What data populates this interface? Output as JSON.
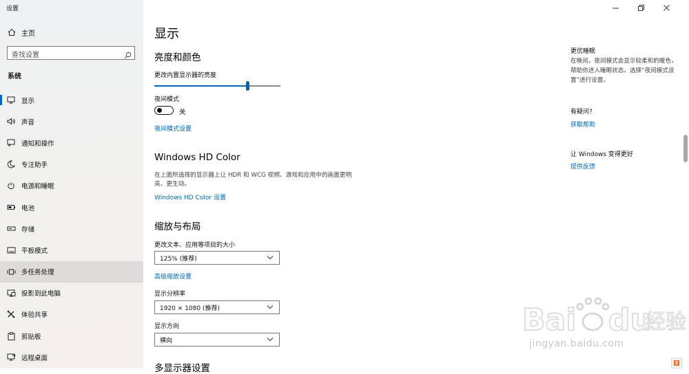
{
  "app": {
    "title": "设置"
  },
  "sidebar": {
    "home_label": "主页",
    "search_placeholder": "查找设置",
    "section_label": "系统",
    "items": [
      {
        "label": "显示",
        "icon": "monitor-icon"
      },
      {
        "label": "声音",
        "icon": "speaker-icon"
      },
      {
        "label": "通知和操作",
        "icon": "notification-icon"
      },
      {
        "label": "专注助手",
        "icon": "moon-icon"
      },
      {
        "label": "电源和睡眠",
        "icon": "power-icon"
      },
      {
        "label": "电池",
        "icon": "battery-icon"
      },
      {
        "label": "存储",
        "icon": "storage-icon"
      },
      {
        "label": "平板模式",
        "icon": "tablet-icon"
      },
      {
        "label": "多任务处理",
        "icon": "multitask-icon"
      },
      {
        "label": "投影到此电脑",
        "icon": "project-icon"
      },
      {
        "label": "体验共享",
        "icon": "share-icon"
      },
      {
        "label": "剪贴板",
        "icon": "clipboard-icon"
      },
      {
        "label": "远程桌面",
        "icon": "remote-icon"
      }
    ],
    "selected_index": 0,
    "hovered_index": 8
  },
  "main": {
    "page_title": "显示",
    "brightness": {
      "heading": "亮度和颜色",
      "slider_label": "更改内置显示器的亮度",
      "slider_value": 0.74,
      "night_label": "夜间模式",
      "night_state": "关",
      "night_link": "夜间模式设置"
    },
    "hdr": {
      "heading": "Windows HD Color",
      "desc": "在上面所选择的显示器上让 HDR 和 WCG 视频、游戏和应用中的画面更明亮、更生动。",
      "link": "Windows HD Color 设置"
    },
    "scale": {
      "heading": "缩放与布局",
      "scale_label": "更改文本、应用等项目的大小",
      "scale_value": "125% (推荐)",
      "advanced_link": "高级缩放设置",
      "res_label": "显示分辨率",
      "res_value": "1920 × 1080 (推荐)",
      "orient_label": "显示方向",
      "orient_value": "横向"
    },
    "multi_heading": "多显示器设置"
  },
  "right": {
    "night_title": "更优睡眠",
    "night_text": "在晚间，夜间模式会显示较柔和的暖色，帮助你进入睡眠状态。选择“夜间模式设置”进行设置。",
    "question_title": "有疑问?",
    "help_link": "获取帮助",
    "improve_title": "让 Windows 变得更好",
    "feedback_link": "提供反馈"
  },
  "watermark": {
    "url": "jingyan.baidu.com"
  },
  "colors": {
    "accent": "#0067c0",
    "link": "#0067b8"
  }
}
